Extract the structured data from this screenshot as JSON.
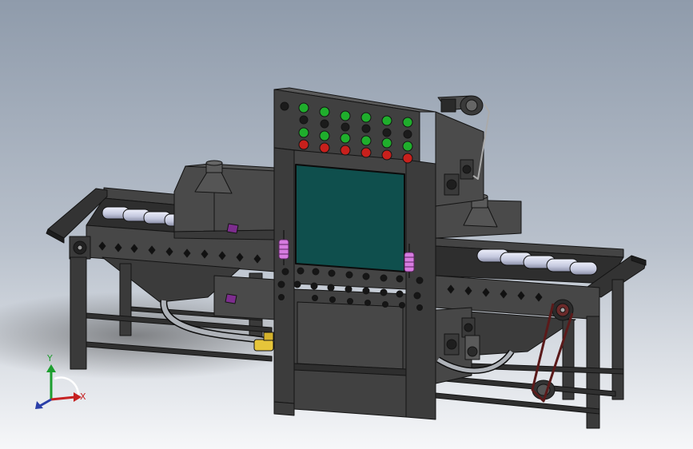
{
  "viewport": {
    "background_top": "#8f9bab",
    "background_bottom": "#f6f7f9"
  },
  "machine": {
    "body_color": "#3f3f3f",
    "edge_color": "#141414",
    "window_color": "#0f4f4d",
    "roller_color": "#cfd2e6",
    "green_button_color": "#1fae2c",
    "red_button_color": "#c8201c",
    "spring_color": "#d77be0",
    "handle_color": "#7d2d8e",
    "pipe_color": "#aeb2b8",
    "fitting_color": "#e6c53a"
  },
  "triad": {
    "y_label": "Y",
    "x_label": "X",
    "y_color": "#1d9e2f",
    "x_color": "#c62222",
    "z_color": "#2a3ea8"
  }
}
